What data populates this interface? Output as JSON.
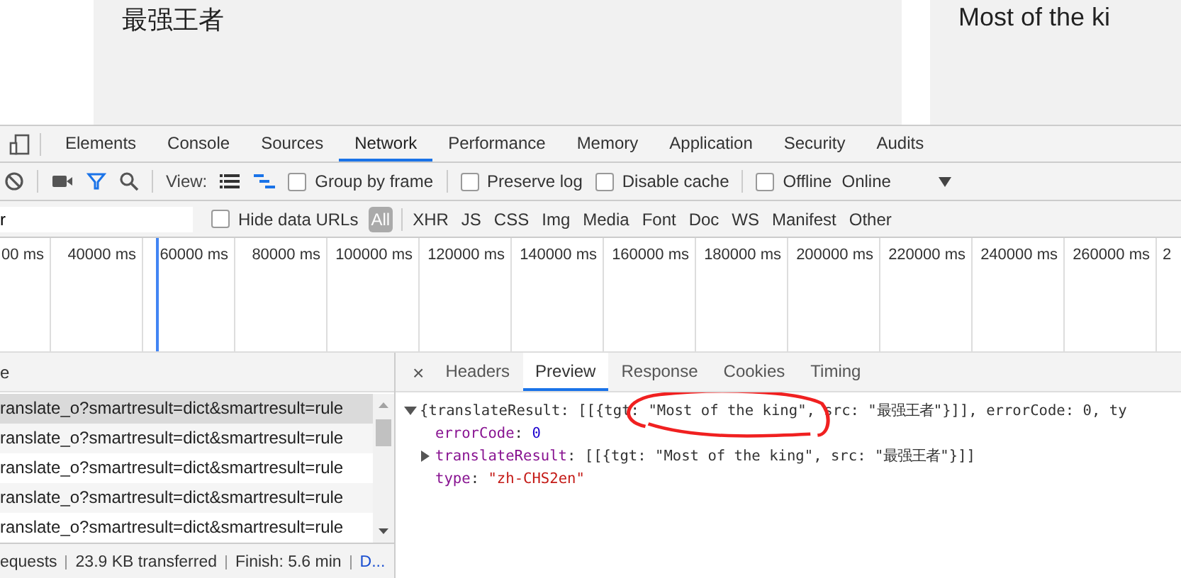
{
  "page": {
    "cards": [
      {
        "text": "最强王者"
      },
      {
        "text": "Most of the ki"
      }
    ]
  },
  "devtools": {
    "tabs": [
      {
        "label": "Elements",
        "selected": false
      },
      {
        "label": "Console",
        "selected": false
      },
      {
        "label": "Sources",
        "selected": false
      },
      {
        "label": "Network",
        "selected": true
      },
      {
        "label": "Performance",
        "selected": false
      },
      {
        "label": "Memory",
        "selected": false
      },
      {
        "label": "Application",
        "selected": false
      },
      {
        "label": "Security",
        "selected": false
      },
      {
        "label": "Audits",
        "selected": false
      }
    ],
    "toolbar": {
      "filter_on": true,
      "view_label": "View:",
      "views": [
        {
          "kind": "list",
          "selected": false
        },
        {
          "kind": "waterfall",
          "selected": true
        }
      ],
      "checkbox_groups": [
        [
          {
            "label": "Group by frame",
            "checked": false
          }
        ],
        [
          {
            "label": "Preserve log",
            "checked": false
          },
          {
            "label": "Disable cache",
            "checked": false
          }
        ],
        [
          {
            "label": "Offline",
            "checked": false
          }
        ]
      ],
      "throttle": "Online"
    },
    "filter_bar": {
      "filter_value": "r",
      "hide_data_urls": {
        "label": "Hide data URLs",
        "checked": false
      },
      "types": [
        {
          "label": "All",
          "selected": true
        },
        {
          "label": "XHR",
          "selected": false
        },
        {
          "label": "JS",
          "selected": false
        },
        {
          "label": "CSS",
          "selected": false
        },
        {
          "label": "Img",
          "selected": false
        },
        {
          "label": "Media",
          "selected": false
        },
        {
          "label": "Font",
          "selected": false
        },
        {
          "label": "Doc",
          "selected": false
        },
        {
          "label": "WS",
          "selected": false
        },
        {
          "label": "Manifest",
          "selected": false
        },
        {
          "label": "Other",
          "selected": false
        }
      ]
    },
    "timeline": {
      "ticks": [
        "00 ms",
        "40000 ms",
        "60000 ms",
        "80000 ms",
        "100000 ms",
        "120000 ms",
        "140000 ms",
        "160000 ms",
        "180000 ms",
        "200000 ms",
        "220000 ms",
        "240000 ms",
        "260000 ms",
        "2"
      ]
    },
    "requests": {
      "column": "e",
      "rows": [
        {
          "name": "ranslate_o?smartresult=dict&smartresult=rule",
          "selected": true
        },
        {
          "name": "ranslate_o?smartresult=dict&smartresult=rule",
          "selected": false
        },
        {
          "name": "ranslate_o?smartresult=dict&smartresult=rule",
          "selected": false
        },
        {
          "name": "ranslate_o?smartresult=dict&smartresult=rule",
          "selected": false
        },
        {
          "name": "ranslate_o?smartresult=dict&smartresult=rule",
          "selected": false
        }
      ]
    },
    "status_bar": [
      {
        "text": "equests",
        "kind": "text"
      },
      {
        "text": "23.9 KB transferred",
        "kind": "text"
      },
      {
        "text": "Finish: 5.6 min",
        "kind": "text"
      },
      {
        "text": "D...",
        "kind": "link"
      }
    ],
    "detail": {
      "close": "×",
      "tabs": [
        {
          "label": "Headers",
          "selected": false
        },
        {
          "label": "Preview",
          "selected": true
        },
        {
          "label": "Response",
          "selected": false
        },
        {
          "label": "Cookies",
          "selected": false
        },
        {
          "label": "Timing",
          "selected": false
        }
      ],
      "preview": [
        {
          "kind": "node",
          "expanded": true,
          "parts": [
            {
              "kind": "plain",
              "text": "{translateResult: [[{tgt: "
            },
            {
              "kind": "plain",
              "text": "\"Most of the king\",",
              "circled": true
            },
            {
              "kind": "plain",
              "text": " src: \"最强王者\"}]], errorCode: 0, ty"
            }
          ]
        },
        {
          "kind": "leaf",
          "parts": [
            {
              "kind": "key",
              "text": "errorCode"
            },
            {
              "kind": "plain",
              "text": ": "
            },
            {
              "kind": "number",
              "text": "0"
            }
          ]
        },
        {
          "kind": "node",
          "expanded": false,
          "parts": [
            {
              "kind": "key",
              "text": "translateResult"
            },
            {
              "kind": "plain",
              "text": ": [[{tgt: \"Most of the king\", src: \"最强王者\"}]]"
            }
          ]
        },
        {
          "kind": "leaf",
          "parts": [
            {
              "kind": "key",
              "text": "type"
            },
            {
              "kind": "plain",
              "text": ": "
            },
            {
              "kind": "string",
              "text": "\"zh-CHS2en\""
            }
          ]
        }
      ]
    }
  }
}
